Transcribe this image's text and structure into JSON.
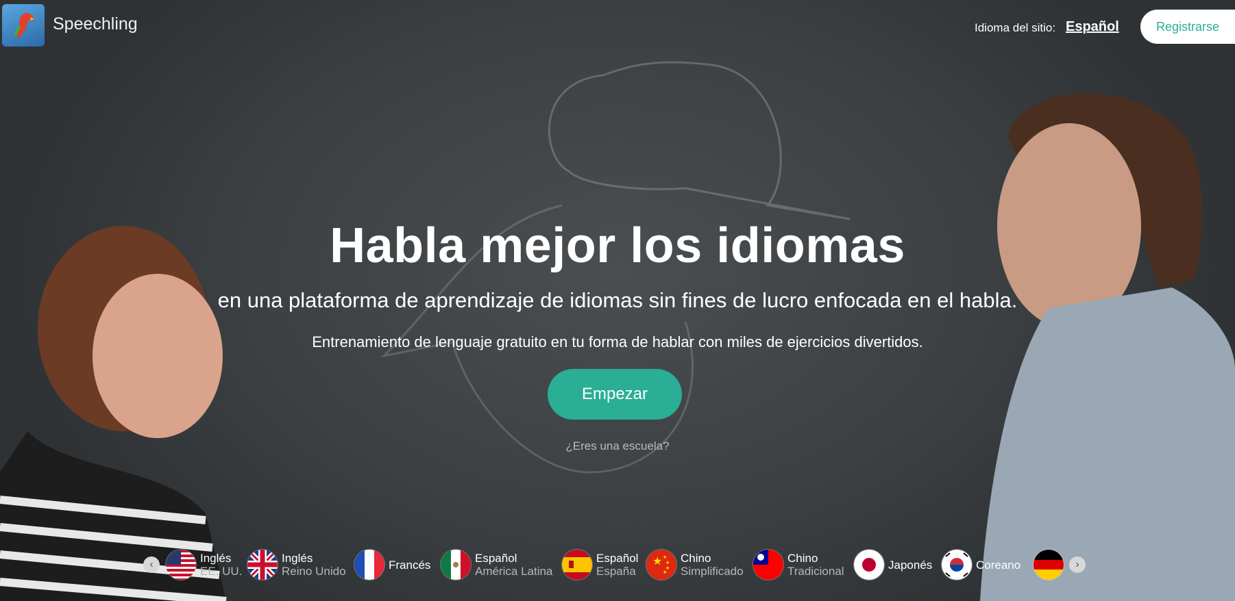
{
  "header": {
    "brand": "Speechling",
    "site_language_label": "Idioma del sitio:",
    "site_language_value": "Español",
    "signup_label": "Registrarse"
  },
  "hero": {
    "headline": "Habla mejor los idiomas",
    "subheadline": "en una plataforma de aprendizaje de idiomas sin fines de lucro enfocada en el habla.",
    "tagline": "Entrenamiento de lenguaje gratuito en tu forma de hablar con miles de ejercicios divertidos.",
    "cta_label": "Empezar",
    "school_link": "¿Eres una escuela?"
  },
  "languages": [
    {
      "name": "Inglés",
      "variant": "EE. UU.",
      "flag": "us-flag-icon"
    },
    {
      "name": "Inglés",
      "variant": "Reino Unido",
      "flag": "uk-flag-icon"
    },
    {
      "name": "Francés",
      "variant": "",
      "flag": "france-flag-icon"
    },
    {
      "name": "Español",
      "variant": "América Latina",
      "flag": "mexico-flag-icon"
    },
    {
      "name": "Español",
      "variant": "España",
      "flag": "spain-flag-icon"
    },
    {
      "name": "Chino",
      "variant": "Simplificado",
      "flag": "china-flag-icon"
    },
    {
      "name": "Chino",
      "variant": "Tradicional",
      "flag": "taiwan-flag-icon"
    },
    {
      "name": "Japonés",
      "variant": "",
      "flag": "japan-flag-icon"
    },
    {
      "name": "Coreano",
      "variant": "",
      "flag": "korea-flag-icon"
    },
    {
      "name": "",
      "variant": "",
      "flag": "germany-flag-icon"
    }
  ],
  "colors": {
    "accent": "#2aae96",
    "background": "#3d4142"
  }
}
